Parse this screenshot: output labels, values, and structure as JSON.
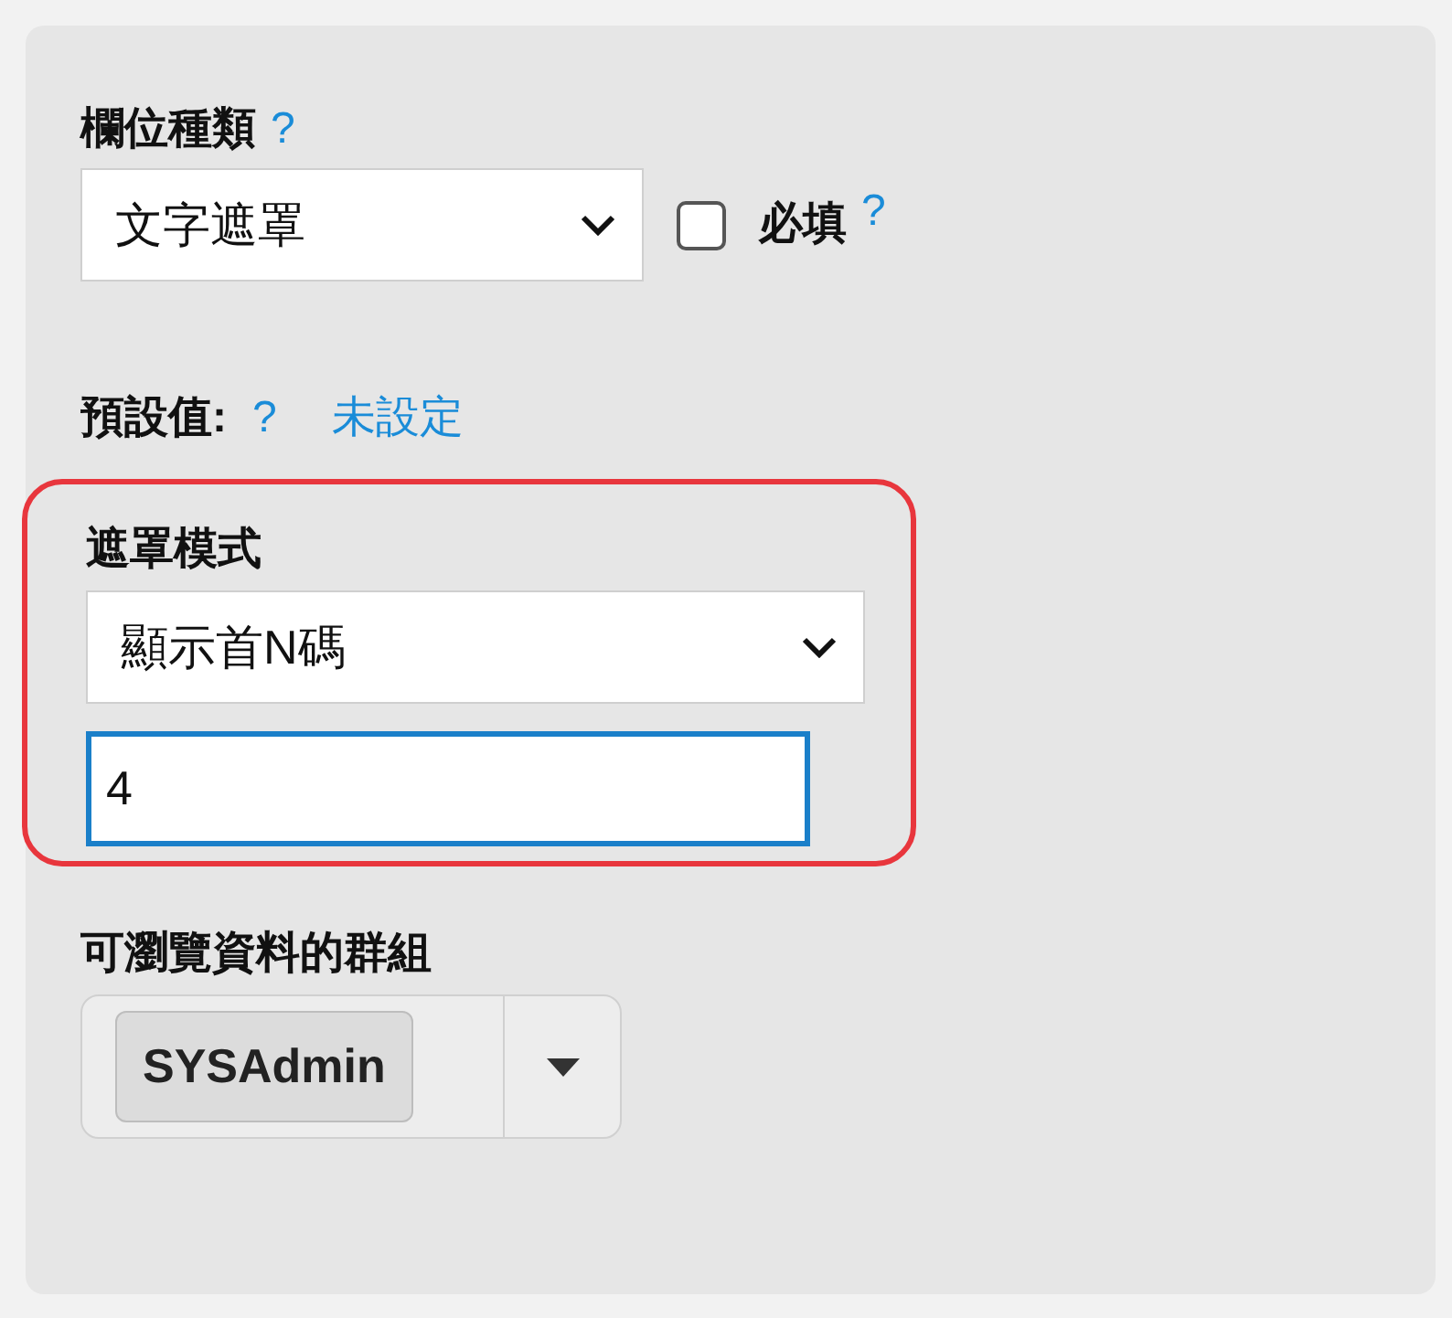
{
  "field_type": {
    "label": "欄位種類",
    "help": "?",
    "value": "文字遮罩"
  },
  "required": {
    "label": "必填",
    "checked": false,
    "help": "?"
  },
  "default_value": {
    "label": "預設值:",
    "help": "?",
    "value": "未設定"
  },
  "mask_mode": {
    "label": "遮罩模式",
    "value": "顯示首N碼",
    "input_value": "4",
    "highlighted": true
  },
  "groups": {
    "label": "可瀏覽資料的群組",
    "tags": [
      "SYSAdmin"
    ]
  }
}
